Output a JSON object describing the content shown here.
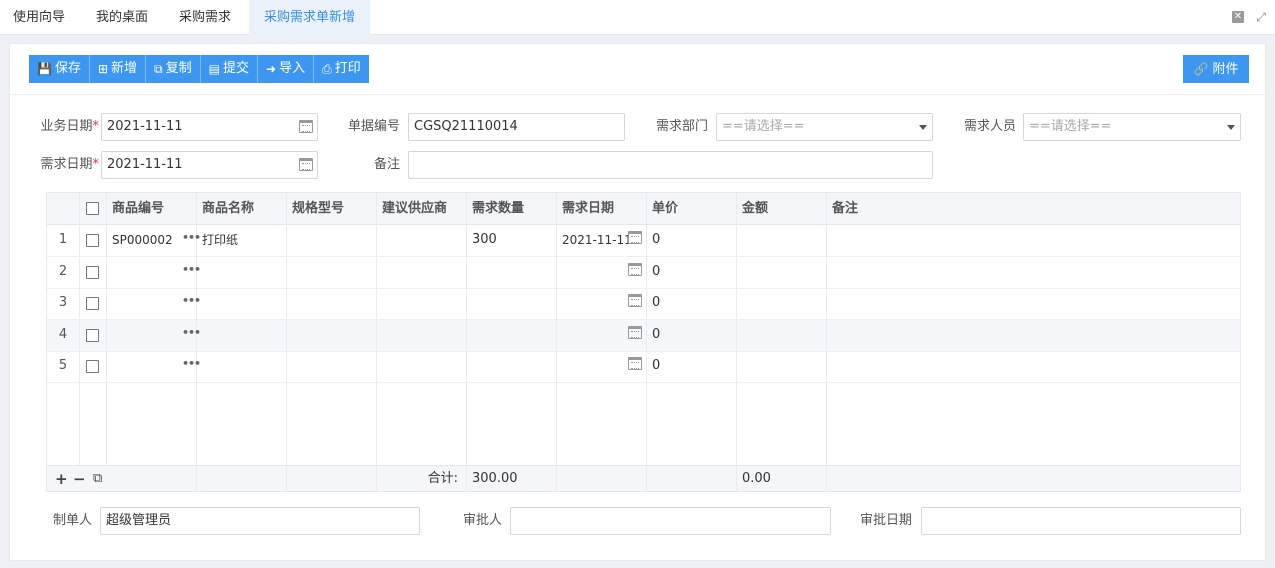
{
  "tabs": [
    {
      "label": "使用向导",
      "active": false
    },
    {
      "label": "我的桌面",
      "active": false
    },
    {
      "label": "采购需求",
      "active": false
    },
    {
      "label": "采购需求单新增",
      "active": true
    }
  ],
  "toolbar": {
    "save": "保存",
    "add": "新增",
    "copy": "复制",
    "submit": "提交",
    "import": "导入",
    "print": "打印",
    "attach": "附件"
  },
  "form": {
    "biz_date_label": "业务日期",
    "biz_date": "2021-11-11",
    "doc_no_label": "单据编号",
    "doc_no": "CGSQ21110014",
    "dept_label": "需求部门",
    "dept_placeholder": "==请选择==",
    "person_label": "需求人员",
    "person_placeholder": "==请选择==",
    "need_date_label": "需求日期",
    "need_date": "2021-11-11",
    "remark_label": "备注",
    "remark": "",
    "required_mark": "*"
  },
  "grid": {
    "columns": [
      "商品编号",
      "商品名称",
      "规格型号",
      "建议供应商",
      "需求数量",
      "需求日期",
      "单价",
      "金额",
      "备注"
    ],
    "rows": [
      {
        "no": "1",
        "code": "SP000002",
        "name": "打印纸",
        "spec": "",
        "supplier": "",
        "qty": "300",
        "date": "2021-11-11",
        "price": "0",
        "amount": "",
        "remark": ""
      },
      {
        "no": "2",
        "code": "",
        "name": "",
        "spec": "",
        "supplier": "",
        "qty": "",
        "date": "",
        "price": "0",
        "amount": "",
        "remark": ""
      },
      {
        "no": "3",
        "code": "",
        "name": "",
        "spec": "",
        "supplier": "",
        "qty": "",
        "date": "",
        "price": "0",
        "amount": "",
        "remark": ""
      },
      {
        "no": "4",
        "code": "",
        "name": "",
        "spec": "",
        "supplier": "",
        "qty": "",
        "date": "",
        "price": "0",
        "amount": "",
        "remark": ""
      },
      {
        "no": "5",
        "code": "",
        "name": "",
        "spec": "",
        "supplier": "",
        "qty": "",
        "date": "",
        "price": "0",
        "amount": "",
        "remark": ""
      }
    ],
    "footer": {
      "total_label": "合计:",
      "total_qty": "300.00",
      "total_amount": "0.00"
    }
  },
  "approval": {
    "maker_label": "制单人",
    "maker": "超级管理员",
    "approver_label": "审批人",
    "approver": "",
    "approve_date_label": "审批日期",
    "approve_date": ""
  },
  "colors": {
    "accent": "#3d97f0",
    "active_tab_text": "#3a8ee6",
    "required": "#e33333"
  }
}
